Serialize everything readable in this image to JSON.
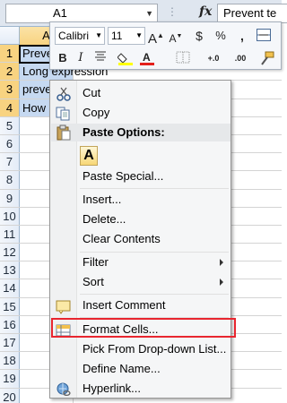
{
  "formula_bar": {
    "name_box": "A1",
    "fx_label": "fx",
    "content": "Prevent te"
  },
  "grid": {
    "column_header": "A",
    "rows": [
      {
        "num": "1",
        "text": "Preve"
      },
      {
        "num": "2",
        "text": "Long expression"
      },
      {
        "num": "3",
        "text": "preve"
      },
      {
        "num": "4",
        "text": "How"
      },
      {
        "num": "5",
        "text": ""
      },
      {
        "num": "6",
        "text": ""
      },
      {
        "num": "7",
        "text": ""
      },
      {
        "num": "8",
        "text": ""
      },
      {
        "num": "9",
        "text": ""
      },
      {
        "num": "10",
        "text": ""
      },
      {
        "num": "11",
        "text": ""
      },
      {
        "num": "12",
        "text": ""
      },
      {
        "num": "13",
        "text": ""
      },
      {
        "num": "14",
        "text": ""
      },
      {
        "num": "15",
        "text": ""
      },
      {
        "num": "16",
        "text": ""
      },
      {
        "num": "17",
        "text": ""
      },
      {
        "num": "18",
        "text": ""
      },
      {
        "num": "19",
        "text": ""
      },
      {
        "num": "20",
        "text": ""
      }
    ]
  },
  "mini_toolbar": {
    "font": "Calibri",
    "size": "11",
    "bold": "B",
    "italic": "I",
    "grow_font": "A",
    "shrink_font": "A",
    "currency": "$",
    "percent": "%",
    "comma": ",",
    "inc_decimal": "+.0",
    "dec_decimal": ".00"
  },
  "context_menu": {
    "cut": "Cut",
    "copy": "Copy",
    "paste_options": "Paste Options:",
    "paste_button": "A",
    "paste_special": "Paste Special...",
    "insert": "Insert...",
    "delete": "Delete...",
    "clear_contents": "Clear Contents",
    "filter": "Filter",
    "sort": "Sort",
    "insert_comment": "Insert Comment",
    "format_cells": "Format Cells...",
    "pick_list": "Pick From Drop-down List...",
    "define_name": "Define Name...",
    "hyperlink": "Hyperlink..."
  },
  "colors": {
    "highlight_border": "#e8262f",
    "selection": "#c6d9f1",
    "header_selected": "#f8d381"
  }
}
